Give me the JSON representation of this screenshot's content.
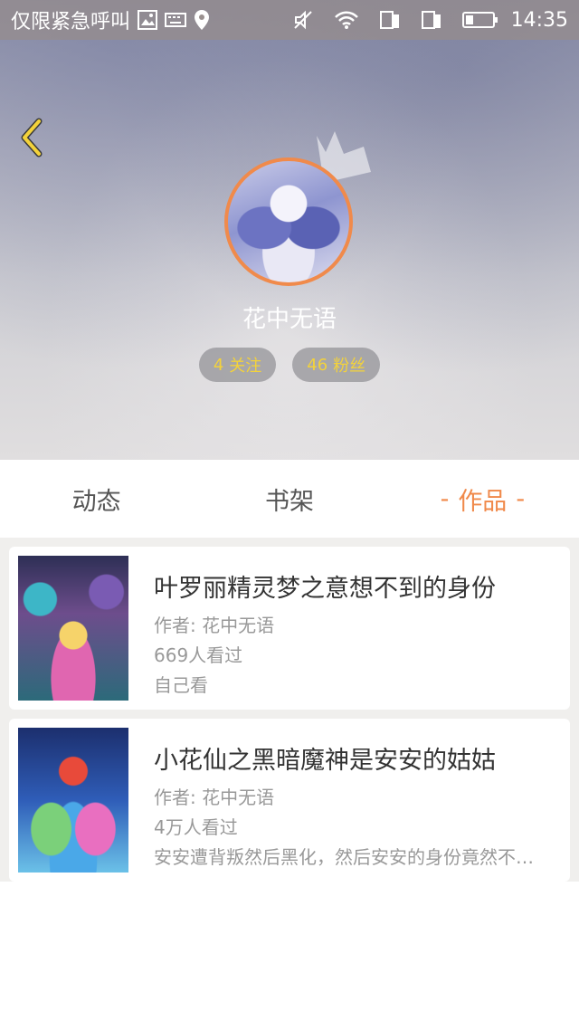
{
  "status_bar": {
    "carrier": "仅限紧急呼叫",
    "time": "14:35"
  },
  "profile": {
    "username": "花中无语",
    "follow_count": "4",
    "follow_label": "关注",
    "fans_count": "46",
    "fans_label": "粉丝"
  },
  "tabs": [
    {
      "label": "动态",
      "active": false
    },
    {
      "label": "书架",
      "active": false
    },
    {
      "label": "作品",
      "active": true
    }
  ],
  "tab_active_decoration": "-",
  "works": [
    {
      "title": "叶罗丽精灵梦之意想不到的身份",
      "author": "作者: 花中无语",
      "views": "669人看过",
      "description": "自己看"
    },
    {
      "title": "小花仙之黑暗魔神是安安的姑姑",
      "author": "作者: 花中无语",
      "views": "4万人看过",
      "description": "安安遭背叛然后黑化，然后安安的身份竟然不…"
    }
  ],
  "colors": {
    "accent": "#f0894a",
    "stat_text": "#f3d23b",
    "back_icon": "#f3d23b"
  }
}
